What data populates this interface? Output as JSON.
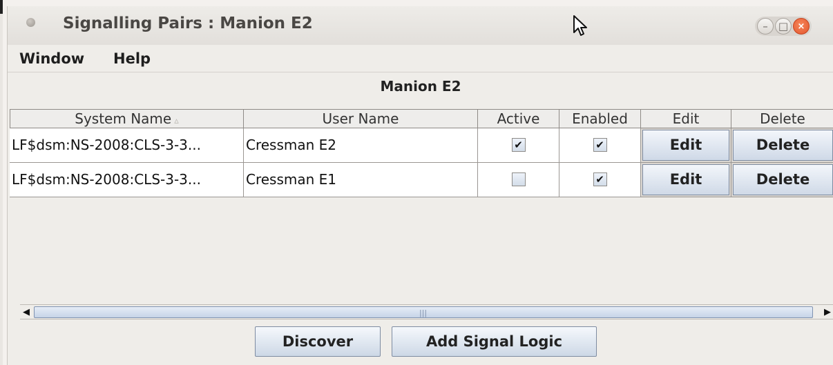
{
  "window": {
    "title": "Signalling Pairs : Manion E2",
    "controls": {
      "minimize_glyph": "–",
      "maximize_glyph": "□",
      "close_glyph": "×"
    }
  },
  "menubar": {
    "items": [
      "Window",
      "Help"
    ]
  },
  "table": {
    "title": "Manion E2",
    "sort_glyph": "▵",
    "columns": [
      "System Name",
      "User Name",
      "Active",
      "Enabled",
      "Edit",
      "Delete"
    ],
    "rows": [
      {
        "system_name": "LF$dsm:NS-2008:CLS-3-3...",
        "user_name": "Cressman E2",
        "active": true,
        "enabled": true,
        "edit": "Edit",
        "delete": "Delete"
      },
      {
        "system_name": "LF$dsm:NS-2008:CLS-3-3...",
        "user_name": "Cressman E1",
        "active": false,
        "enabled": true,
        "edit": "Edit",
        "delete": "Delete"
      }
    ]
  },
  "scrollbar": {
    "left_arrow": "◀",
    "right_arrow": "▶",
    "grip": "|||"
  },
  "buttons": {
    "discover": "Discover",
    "add_signal_logic": "Add Signal Logic"
  },
  "icons": {
    "check_glyph": "✔"
  },
  "colors": {
    "accent_close": "#e4572e",
    "button_blue": "#cfd9e7",
    "background": "#efede9"
  }
}
